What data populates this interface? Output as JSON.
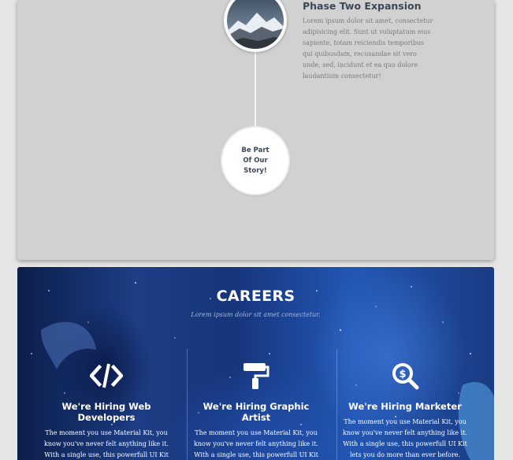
{
  "timeline": {
    "phase_title": "Phase Two Expansion",
    "phase_text": "Lorem ipsum dolor sit amet, consectetur adipisicing elit. Sunt ut voluptatum eius sapiente, totam reiciendis temporibus qui quibusdam, recusandae sit vero unde, sed, incidunt et ea quo dolore laudantium consectetur!",
    "cta_label": "Be Part Of Our Story!",
    "photo_icon": "mountain-photo"
  },
  "careers": {
    "title": "CAREERS",
    "subtitle": "Lorem ipsum dolor sit amet consectetur.",
    "jobs": [
      {
        "icon": "code-icon",
        "title": "We're Hiring Web Developers",
        "description": "The moment you use Material Kit, you know you've never felt anything like it. With a single use, this powerfull UI Kit lets you do"
      },
      {
        "icon": "paint-roller-icon",
        "title": "We're Hiring Graphic Artist",
        "description": "The moment you use Material Kit, you know you've never felt anything like it. With a single use, this powerfull UI Kit lets you do"
      },
      {
        "icon": "search-dollar-icon",
        "title": "We're Hiring Marketer",
        "description": "The moment you use Material Kit, you know you've never felt anything like it. With a single use, this powerfull UI Kit lets you do more than ever before."
      }
    ]
  },
  "colors": {
    "title_text": "#3c4858",
    "body_text": "#7b7b7b",
    "card_bg": "#d1d1d1",
    "careers_bg": "#1d3e86"
  }
}
